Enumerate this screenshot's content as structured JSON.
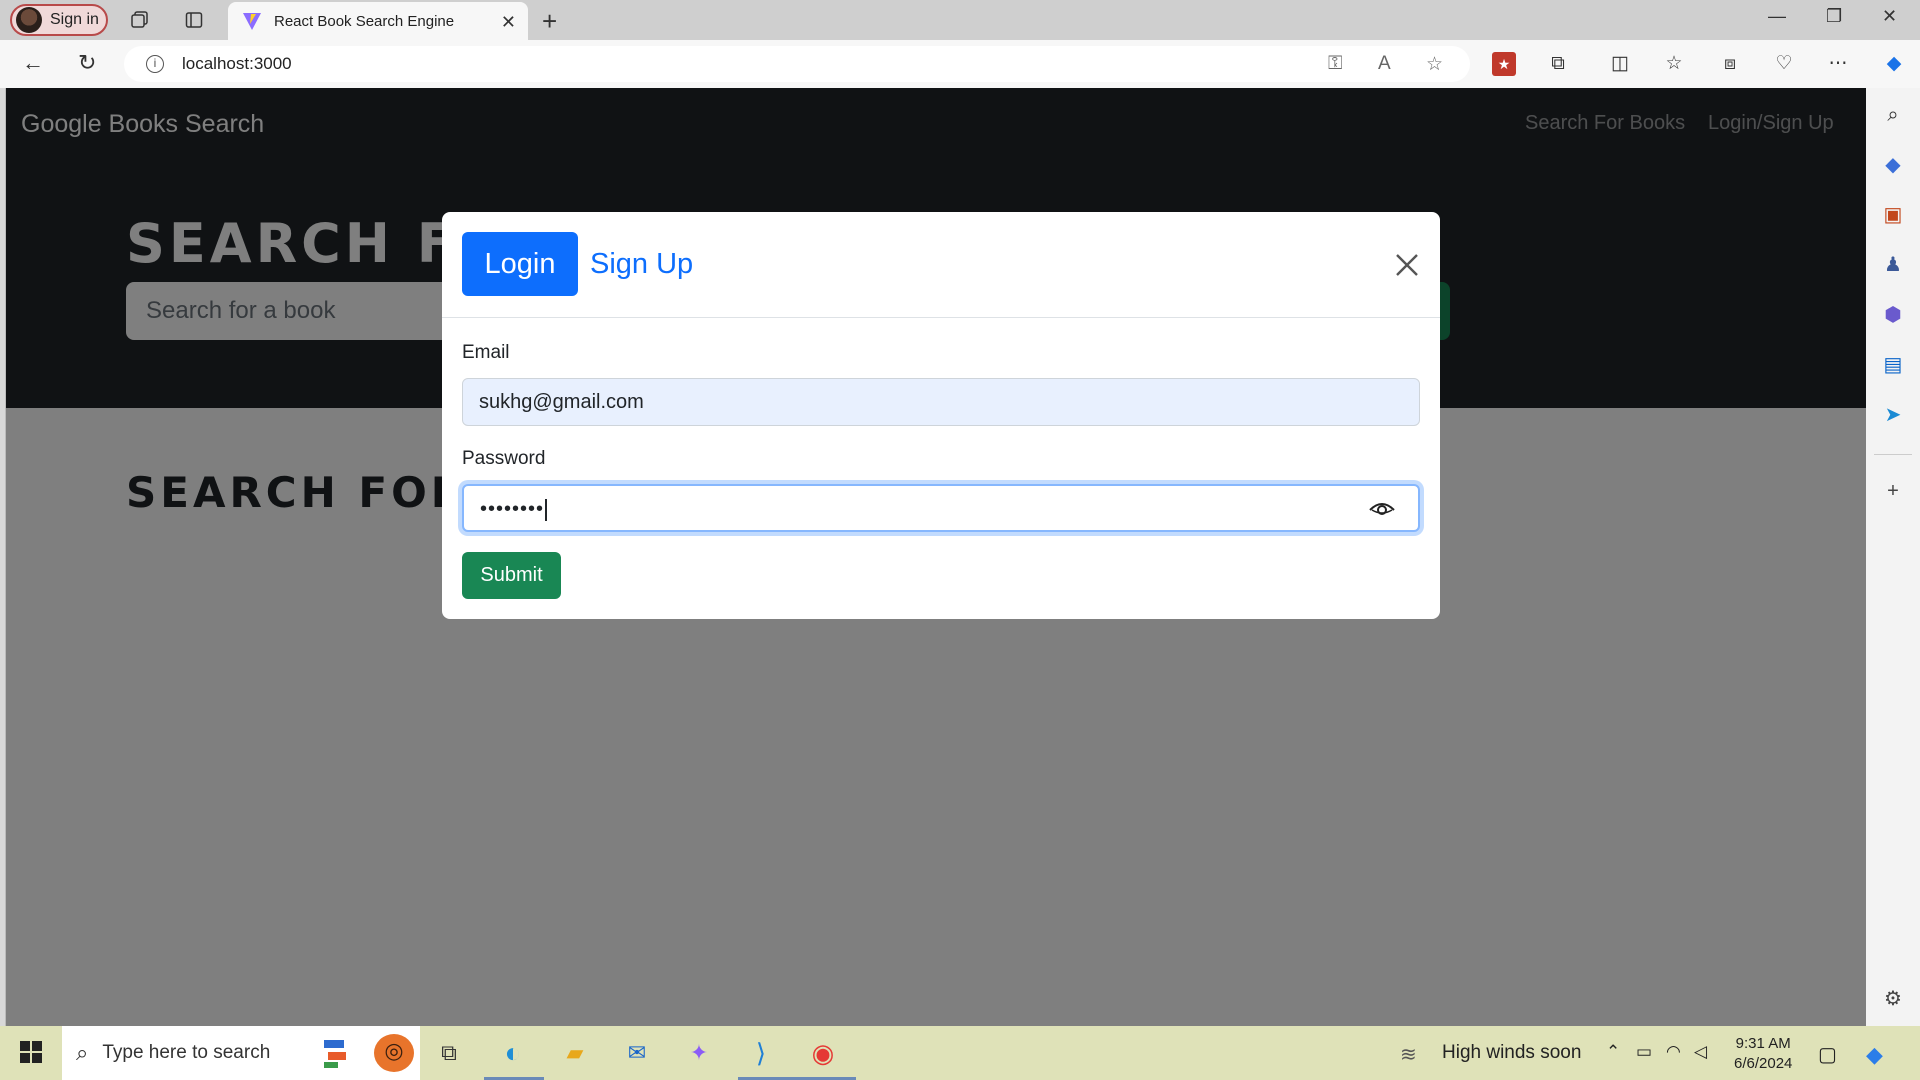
{
  "browser": {
    "profile_label": "Sign in",
    "tab_title": "React Book Search Engine",
    "url": "localhost:3000"
  },
  "app": {
    "brand": "Google Books Search",
    "nav": [
      "Search For Books",
      "Login/Sign Up"
    ],
    "hero_title": "SEARCH FOR BOOKS!",
    "search_placeholder": "Search for a book",
    "results_title": "SEARCH FOR A BOOK TO BEGIN"
  },
  "modal": {
    "tab_login": "Login",
    "tab_signup": "Sign Up",
    "email_label": "Email",
    "email_value": "sukhg@gmail.com",
    "password_label": "Password",
    "password_value": "••••••••",
    "submit_label": "Submit"
  },
  "taskbar": {
    "search_placeholder": "Type here to search",
    "weather": "High winds soon",
    "time": "9:31 AM",
    "date": "6/6/2024"
  },
  "colors": {
    "primary": "#0d6efd",
    "success": "#198754",
    "navbar": "#212529"
  }
}
